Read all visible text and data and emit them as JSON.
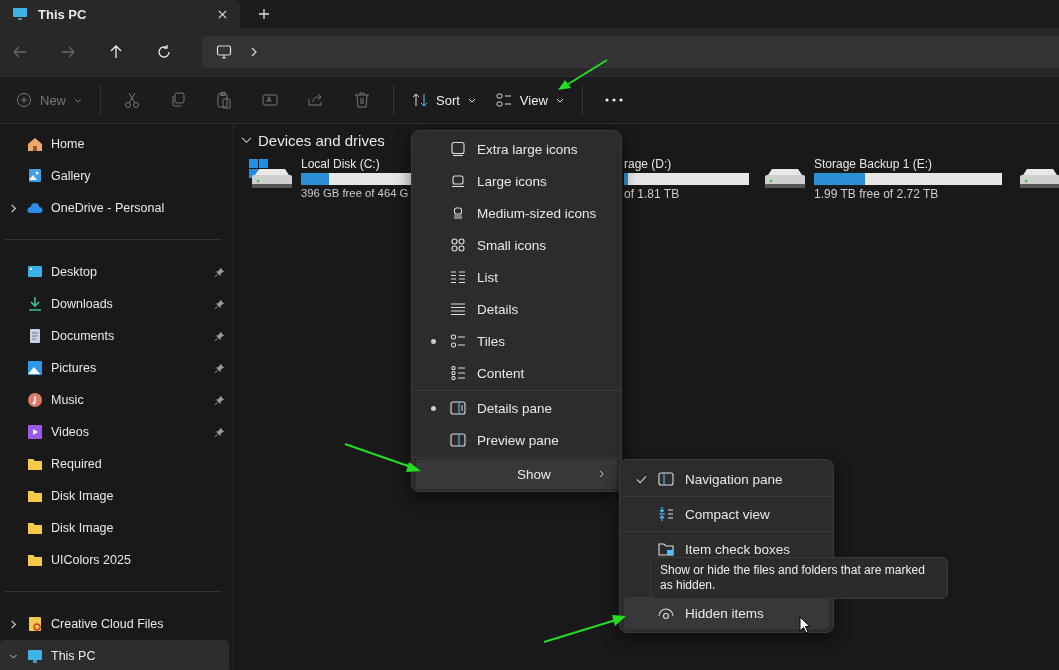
{
  "tab": {
    "title": "This PC"
  },
  "nav": {
    "back_disabled": true,
    "forward_disabled": true
  },
  "toolbar": {
    "new": {
      "label": "New",
      "disabled": true
    },
    "edit_actions": [
      {
        "disabled": true
      },
      {
        "disabled": true
      },
      {
        "disabled": true
      },
      {
        "disabled": true
      },
      {
        "disabled": true
      },
      {
        "disabled": true
      }
    ],
    "sort": {
      "label": "Sort"
    },
    "view": {
      "label": "View"
    }
  },
  "sidebar": {
    "groups": [
      [
        {
          "kind": "home",
          "label": "Home",
          "pinned": false,
          "selected": false
        },
        {
          "kind": "gallery",
          "label": "Gallery",
          "pinned": false,
          "selected": false
        },
        {
          "kind": "cloud",
          "label": "OneDrive - Personal",
          "pinned": false,
          "selected": false,
          "expanded": false
        }
      ],
      [
        {
          "kind": "desktop",
          "label": "Desktop",
          "pinned": true,
          "selected": false
        },
        {
          "kind": "downloads",
          "label": "Downloads",
          "pinned": true,
          "selected": false
        },
        {
          "kind": "documents",
          "label": "Documents",
          "pinned": true,
          "selected": false
        },
        {
          "kind": "pictures",
          "label": "Pictures",
          "pinned": true,
          "selected": false
        },
        {
          "kind": "music",
          "label": "Music",
          "pinned": true,
          "selected": false
        },
        {
          "kind": "videos",
          "label": "Videos",
          "pinned": true,
          "selected": false
        },
        {
          "kind": "folder",
          "label": "Required",
          "pinned": false,
          "selected": false
        },
        {
          "kind": "folder",
          "label": "Disk Image",
          "pinned": false,
          "selected": false
        },
        {
          "kind": "folder",
          "label": "Disk Image",
          "pinned": false,
          "selected": false
        },
        {
          "kind": "folder",
          "label": "UIColors 2025",
          "pinned": false,
          "selected": false
        }
      ],
      [
        {
          "kind": "creative",
          "label": "Creative Cloud Files",
          "pinned": false,
          "selected": false,
          "expanded": false
        },
        {
          "kind": "pc",
          "label": "This PC",
          "pinned": false,
          "selected": true,
          "expanded": true
        }
      ]
    ]
  },
  "content": {
    "section": {
      "title": "Devices and drives",
      "expanded": true
    },
    "drives": [
      {
        "kind": "full",
        "windows": true,
        "name": "Local Disk (C:)",
        "level": 0.15,
        "free": "396 GB free of 464 G"
      },
      {
        "kind": "clipped",
        "name": "rage (D:)",
        "level": 0.03,
        "free": "of 1.81 TB"
      },
      {
        "kind": "full",
        "windows": false,
        "name": "Storage Backup 1 (E:)",
        "level": 0.27,
        "free": "1.99 TB free of 2.72 TB"
      },
      {
        "kind": "icon-only"
      }
    ]
  },
  "view_menu": {
    "sections": [
      [
        {
          "kind": "xl",
          "label": "Extra large icons",
          "selected": false
        },
        {
          "kind": "large",
          "label": "Large icons",
          "selected": false
        },
        {
          "kind": "medium",
          "label": "Medium-sized icons",
          "selected": false
        },
        {
          "kind": "small",
          "label": "Small icons",
          "selected": false
        },
        {
          "kind": "list",
          "label": "List",
          "selected": false
        },
        {
          "kind": "details",
          "label": "Details",
          "selected": false
        },
        {
          "kind": "tiles",
          "label": "Tiles",
          "selected": true
        },
        {
          "kind": "content",
          "label": "Content",
          "selected": false
        }
      ],
      [
        {
          "kind": "detailspane",
          "label": "Details pane",
          "selected": true
        },
        {
          "kind": "previewpane",
          "label": "Preview pane",
          "selected": false
        }
      ]
    ],
    "show": {
      "label": "Show",
      "highlighted": true
    }
  },
  "show_menu": {
    "items": [
      {
        "kind": "navpane",
        "label": "Navigation pane",
        "checked": true,
        "highlighted": false
      },
      {
        "kind": "compact",
        "label": "Compact view",
        "checked": false,
        "highlighted": false
      },
      {
        "kind": "checkboxes",
        "label": "Item check boxes",
        "checked": false,
        "highlighted": false
      },
      {
        "kind": "hidden",
        "label": "Hidden items",
        "checked": false,
        "highlighted": true
      }
    ]
  },
  "tooltip": {
    "text": "Show or hide the files and folders that are marked as hidden."
  }
}
